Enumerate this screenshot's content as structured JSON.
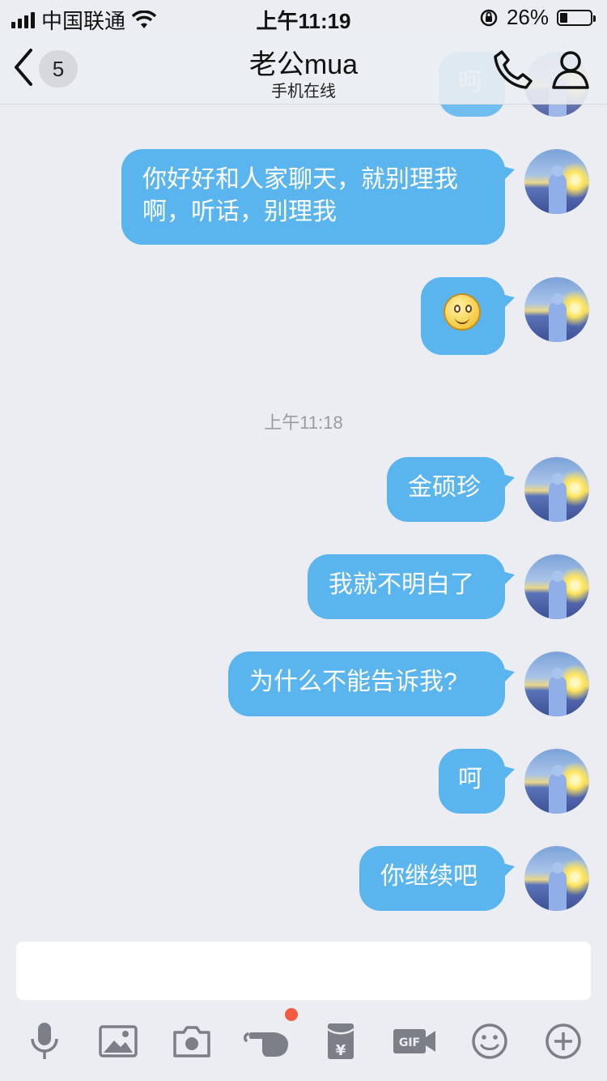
{
  "status_bar": {
    "carrier": "中国联通",
    "time": "上午11:19",
    "battery": "26%",
    "battery_level": 0.26
  },
  "header": {
    "back_count": "5",
    "title": "老公mua",
    "subtitle": "手机在线"
  },
  "messages": [
    {
      "text": "呵",
      "partially_visible": true
    },
    {
      "text": "你好好和人家聊天，就别理我啊，听话，别理我"
    },
    {
      "type": "emoji",
      "icon": "smiley-emoji"
    },
    {
      "text": "金硕珍"
    },
    {
      "text": "我就不明白了"
    },
    {
      "text": "为什么不能告诉我?"
    },
    {
      "text": "呵"
    },
    {
      "text": "你继续吧"
    }
  ],
  "timestamp": "上午11:18",
  "colors": {
    "bubble": "#5ab4ee",
    "background": "#ebedf2",
    "notification_dot": "#f05b41"
  },
  "toolbar": [
    {
      "icon": "microphone-icon"
    },
    {
      "icon": "image-icon"
    },
    {
      "icon": "camera-icon"
    },
    {
      "icon": "poke-hand-icon",
      "has_badge": true
    },
    {
      "icon": "red-packet-icon"
    },
    {
      "icon": "gif-icon"
    },
    {
      "icon": "emoji-icon"
    },
    {
      "icon": "plus-icon"
    }
  ]
}
